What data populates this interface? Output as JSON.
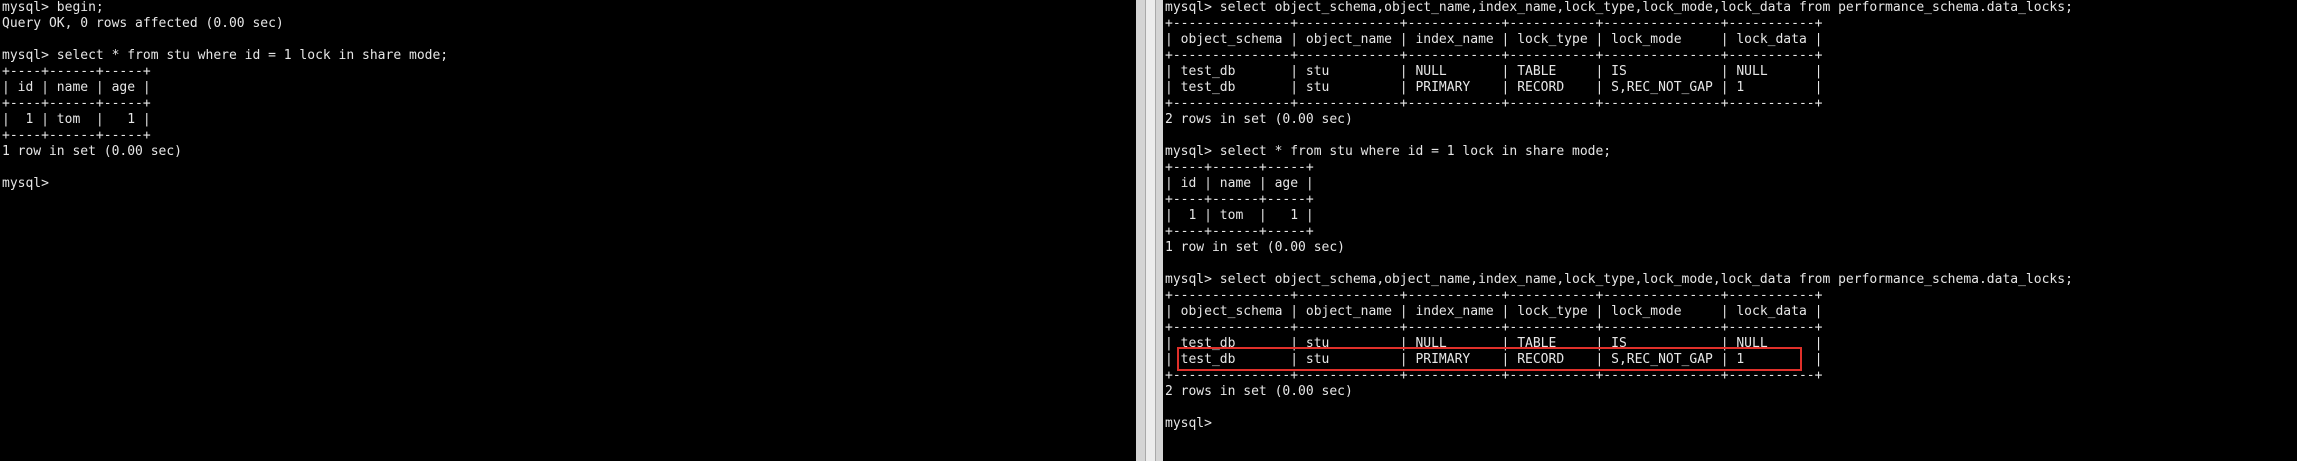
{
  "accent_colors": {
    "background": "#000000",
    "text": "#e6e6e6",
    "highlight": "#e0302a",
    "divider": "#d4d4d4"
  },
  "left_terminal": {
    "lines": [
      "mysql> begin;",
      "Query OK, 0 rows affected (0.00 sec)",
      "",
      "mysql> select * from stu where id = 1 lock in share mode;",
      "+----+------+-----+",
      "| id | name | age |",
      "+----+------+-----+",
      "|  1 | tom  |   1 |",
      "+----+------+-----+",
      "1 row in set (0.00 sec)",
      "",
      "mysql>"
    ]
  },
  "right_terminal": {
    "lines": [
      "mysql> select object_schema,object_name,index_name,lock_type,lock_mode,lock_data from performance_schema.data_locks;",
      "+---------------+-------------+------------+-----------+---------------+-----------+",
      "| object_schema | object_name | index_name | lock_type | lock_mode     | lock_data |",
      "+---------------+-------------+------------+-----------+---------------+-----------+",
      "| test_db       | stu         | NULL       | TABLE     | IS            | NULL      |",
      "| test_db       | stu         | PRIMARY    | RECORD    | S,REC_NOT_GAP | 1         |",
      "+---------------+-------------+------------+-----------+---------------+-----------+",
      "2 rows in set (0.00 sec)",
      "",
      "mysql> select * from stu where id = 1 lock in share mode;",
      "+----+------+-----+",
      "| id | name | age |",
      "+----+------+-----+",
      "|  1 | tom  |   1 |",
      "+----+------+-----+",
      "1 row in set (0.00 sec)",
      "",
      "mysql> select object_schema,object_name,index_name,lock_type,lock_mode,lock_data from performance_schema.data_locks;",
      "+---------------+-------------+------------+-----------+---------------+-----------+",
      "| object_schema | object_name | index_name | lock_type | lock_mode     | lock_data |",
      "+---------------+-------------+------------+-----------+---------------+-----------+",
      "| test_db       | stu         | NULL       | TABLE     | IS            | NULL      |",
      "| test_db       | stu         | PRIMARY    | RECORD    | S,REC_NOT_GAP | 1         |",
      "+---------------+-------------+------------+-----------+---------------+-----------+",
      "2 rows in set (0.00 sec)",
      "",
      "mysql>"
    ]
  }
}
